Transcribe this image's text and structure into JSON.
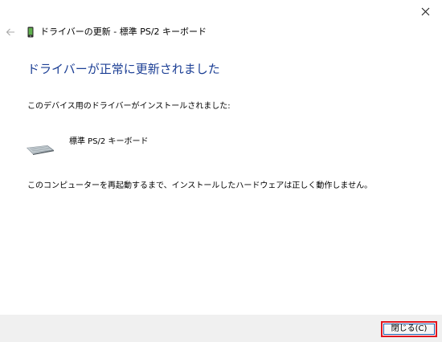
{
  "window": {
    "close_glyph": "✕"
  },
  "header": {
    "title": "ドライバーの更新 - 標準 PS/2 キーボード",
    "icon": "device-phone-icon",
    "back_icon": "back-arrow-icon"
  },
  "main": {
    "heading": "ドライバーが正常に更新されました",
    "installed_message": "このデバイス用のドライバーがインストールされました:",
    "device": {
      "icon": "keyboard-icon",
      "name": "標準 PS/2 キーボード"
    },
    "restart_message": "このコンピューターを再起動するまで、インストールしたハードウェアは正しく動作しません。"
  },
  "footer": {
    "close_button_label": "閉じる(C)"
  },
  "colors": {
    "heading": "#1c3f95",
    "footer_bg": "#f0f0f0",
    "highlight_border": "#e0161f",
    "button_focus_border": "#1e5fb0"
  }
}
